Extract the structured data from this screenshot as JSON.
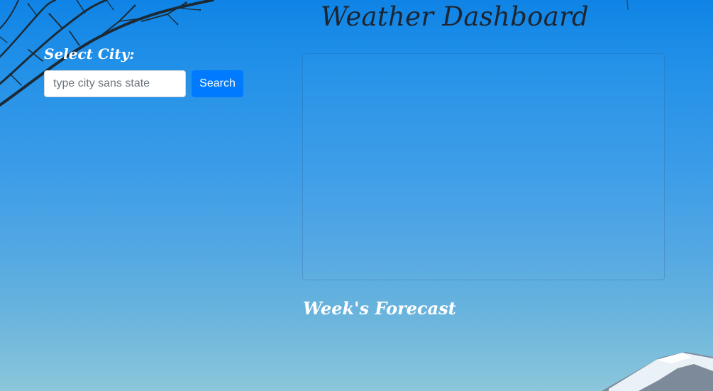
{
  "header": {
    "title": "Weather Dashboard"
  },
  "search": {
    "label": "Select City:",
    "placeholder": "type city sans state",
    "value": "",
    "button_label": "Search"
  },
  "forecast": {
    "heading": "Week's Forecast"
  },
  "colors": {
    "button": "#007bff",
    "sky_top": "#0f84e6",
    "sky_bottom": "#8cc7db",
    "title_text": "#1c2531"
  }
}
